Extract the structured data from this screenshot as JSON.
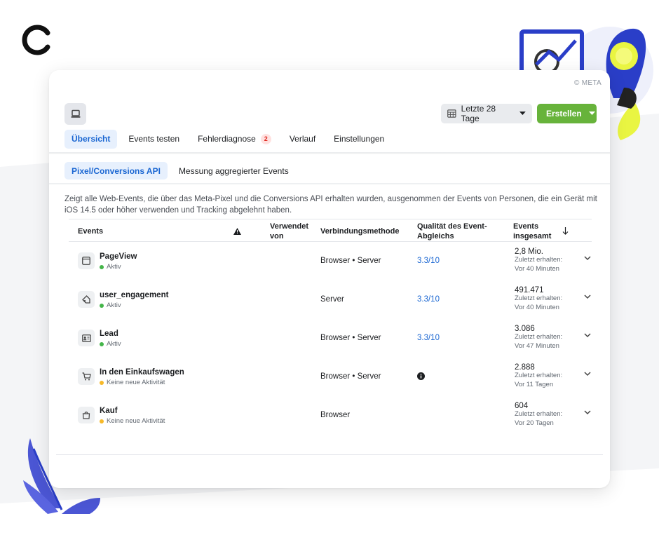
{
  "colors": {
    "accent_blue": "#1a66d2",
    "create_green": "#67b33b",
    "active_dot": "#44b549",
    "inactive_dot": "#f7b928",
    "badge_red": "#e0281f"
  },
  "copyright": "© META",
  "header": {
    "date_range": "Letzte 28 Tage",
    "create_label": "Erstellen"
  },
  "tabs": [
    {
      "label": "Übersicht",
      "active": true
    },
    {
      "label": "Events testen"
    },
    {
      "label": "Fehlerdiagnose",
      "badge": "2"
    },
    {
      "label": "Verlauf"
    },
    {
      "label": "Einstellungen"
    }
  ],
  "subtabs": [
    {
      "label": "Pixel/Conversions API",
      "active": true
    },
    {
      "label": "Messung aggregierter Events"
    }
  ],
  "description": "Zeigt alle Web-Events, die über das Meta-Pixel und die Conversions API erhalten wurden, ausgenommen der Events von Personen, die ein Gerät mit iOS 14.5 oder höher verwenden und Tracking abgelehnt haben.",
  "table": {
    "headers": {
      "events": "Events",
      "used_by": "Verwendet von",
      "method": "Verbindungsmethode",
      "quality": "Qualität des Event-Abgleichs",
      "total": "Events insgesamt"
    },
    "rows": [
      {
        "icon": "browser-window-icon",
        "name": "PageView",
        "status": "Aktiv",
        "method": "Browser • Server",
        "quality": "3.3/10",
        "count": "2,8 Mio.",
        "last_label": "Zuletzt erhalten:",
        "last_value": "Vor 40 Minuten"
      },
      {
        "icon": "tag-icon",
        "name": "user_engagement",
        "status": "Aktiv",
        "method": "Server",
        "quality": "3.3/10",
        "count": "491.471",
        "last_label": "Zuletzt erhalten:",
        "last_value": "Vor 40 Minuten"
      },
      {
        "icon": "id-card-icon",
        "name": "Lead",
        "status": "Aktiv",
        "method": "Browser • Server",
        "quality": "3.3/10",
        "count": "3.086",
        "last_label": "Zuletzt erhalten:",
        "last_value": "Vor 47 Minuten"
      },
      {
        "icon": "cart-icon",
        "name": "In den Einkaufswagen",
        "status": "Keine neue Aktivität",
        "method": "Browser • Server",
        "quality": "",
        "count": "2.888",
        "last_label": "Zuletzt erhalten:",
        "last_value": "Vor 11 Tagen"
      },
      {
        "icon": "shopping-bag-icon",
        "name": "Kauf",
        "status": "Keine neue Aktivität",
        "method": "Browser",
        "quality": "",
        "count": "604",
        "last_label": "Zuletzt erhalten:",
        "last_value": "Vor 20 Tagen"
      }
    ]
  }
}
